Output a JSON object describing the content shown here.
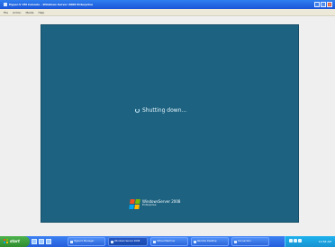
{
  "window": {
    "title": "Hyper-V VM Console - Windows Server 2008 Enterprise",
    "menu": [
      "File",
      "Action",
      "Media",
      "Help"
    ]
  },
  "vm_screen": {
    "status_text": "Shutting down...",
    "brand_line1": "WindowsServer 2008",
    "brand_line2": "Enterprise"
  },
  "taskbar": {
    "start_label": "start",
    "tasks": [
      {
        "label": "Hyper-V Manager"
      },
      {
        "label": "Windows Server 2008"
      },
      {
        "label": "Virtual Machine"
      },
      {
        "label": "Remote Desktop"
      },
      {
        "label": "Connection"
      }
    ],
    "clock": "10:58 AM"
  },
  "colors": {
    "vm_background": "#1d6280",
    "taskbar": "#245edb",
    "tray": "#1792d1"
  }
}
